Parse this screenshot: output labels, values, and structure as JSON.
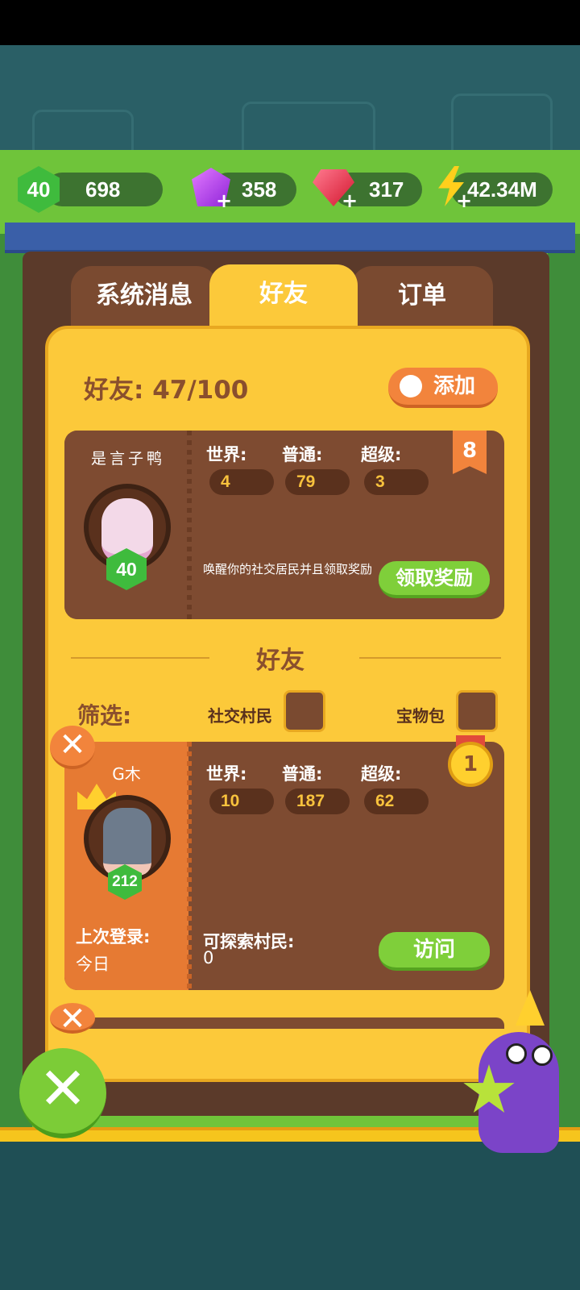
{
  "resources": {
    "level": "40",
    "xp": "698",
    "purple_gems": "358",
    "red_gems": "317",
    "energy": "42.34M"
  },
  "tabs": [
    {
      "label": "系统消息",
      "active": false
    },
    {
      "label": "好友",
      "active": true
    },
    {
      "label": "订单",
      "active": false
    }
  ],
  "friends_header": {
    "count_label": "好友: 47/100",
    "add_label": "添加"
  },
  "self_card": {
    "name": "是言子鸭",
    "level": "40",
    "world_label": "世界:",
    "normal_label": "普通:",
    "super_label": "超级:",
    "world": "4",
    "normal": "79",
    "super": "3",
    "badge": "8",
    "message": "唤醒你的社交居民并且领取奖励",
    "claim_label": "领取奖励"
  },
  "section": {
    "title": "好友"
  },
  "filter": {
    "label": "筛选:",
    "option1": "社交村民",
    "option2": "宝物包"
  },
  "friend_card": {
    "name": "G木",
    "level": "212",
    "rank": "1",
    "world_label": "世界:",
    "normal_label": "普通:",
    "super_label": "超级:",
    "world": "10",
    "normal": "187",
    "super": "62",
    "last_login_label": "上次登录:",
    "last_login": "今日",
    "explorable_label": "可探索村民:",
    "explorable": "0",
    "visit_label": "访问"
  },
  "colors": {
    "panel": "#fcc93a",
    "card": "#7e4b31",
    "accent_orange": "#f2843c",
    "accent_green": "#7fcf3a"
  }
}
